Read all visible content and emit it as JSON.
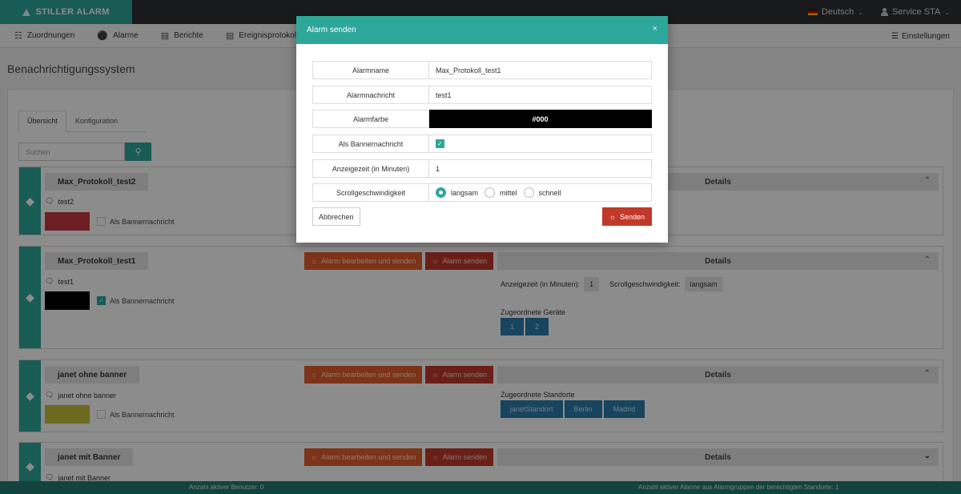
{
  "header": {
    "brand": "STILLER ALARM",
    "language": "Deutsch",
    "user": "Service STA"
  },
  "nav": {
    "items": [
      {
        "label": "Zuordnungen",
        "icon": "sitemap-icon"
      },
      {
        "label": "Alarme",
        "icon": "siren-icon"
      },
      {
        "label": "Berichte",
        "icon": "chart-icon"
      },
      {
        "label": "Ereignisprotokolle",
        "icon": "document-icon"
      }
    ],
    "settings": "Einstellungen"
  },
  "page": {
    "title": "Benachrichtigungssystem",
    "tabs": [
      "Übersicht",
      "Konfiguration"
    ],
    "search_placeholder": "Suchen"
  },
  "alarms": [
    {
      "name": "Max_Protokoll_test2",
      "message": "test2",
      "color": "#c7383f",
      "banner": false,
      "banner_label": "Als Bannernachricht",
      "details": "Details"
    },
    {
      "name": "Max_Protokoll_test1",
      "message": "test1",
      "color": "#000000",
      "banner": true,
      "banner_label": "Als Bannernachricht",
      "edit_label": "Alarm bearbeiten und senden",
      "send_label": "Alarm senden",
      "details": "Details",
      "display_time_label": "Anzeigezeit (in Minuten):",
      "display_time": "1",
      "scroll_label": "Scrollgeschwindigkeit:",
      "scroll": "langsam",
      "assigned_label": "Zugeordnete Geräte",
      "assigned": [
        "1",
        "2"
      ]
    },
    {
      "name": "janet ohne banner",
      "message": "janet ohne banner",
      "color": "#c7c23a",
      "banner": false,
      "banner_label": "Als Bannernachricht",
      "edit_label": "Alarm bearbeiten und senden",
      "send_label": "Alarm senden",
      "details": "Details",
      "assigned_label": "Zugeordnete Standorte",
      "assigned": [
        "janetStandort",
        "Berlin",
        "Madrid"
      ]
    },
    {
      "name": "janet mit Banner",
      "message": "janet mit Banner",
      "edit_label": "Alarm bearbeiten und senden",
      "send_label": "Alarm senden",
      "details": "Details"
    }
  ],
  "modal": {
    "title": "Alarm senden",
    "close": "×",
    "fields": {
      "name_label": "Alarmname",
      "name_value": "Max_Protokoll_test1",
      "message_label": "Alarmnachricht",
      "message_value": "test1",
      "color_label": "Alarmfarbe",
      "color_value": "#000",
      "banner_label": "Als Bannernachricht",
      "time_label": "Anzeigezeit (in Minuten)",
      "time_value": "1",
      "scroll_label": "Scrollgeschwindigkeit",
      "scroll_options": [
        "langsam",
        "mittel",
        "schnell"
      ],
      "scroll_selected": "langsam"
    },
    "cancel": "Abbrechen",
    "send": "Senden"
  },
  "footer": {
    "active_users": "Anzahl aktiver Benutzer: 0",
    "active_alarms": "Anzahl aktiver Alarme aus Alarmgruppen der berechtigten Standorte: 1"
  },
  "colors": {
    "accent": "#2ea79b",
    "danger": "#c0392b",
    "warning": "#e35d2a",
    "info": "#2a7cab"
  }
}
